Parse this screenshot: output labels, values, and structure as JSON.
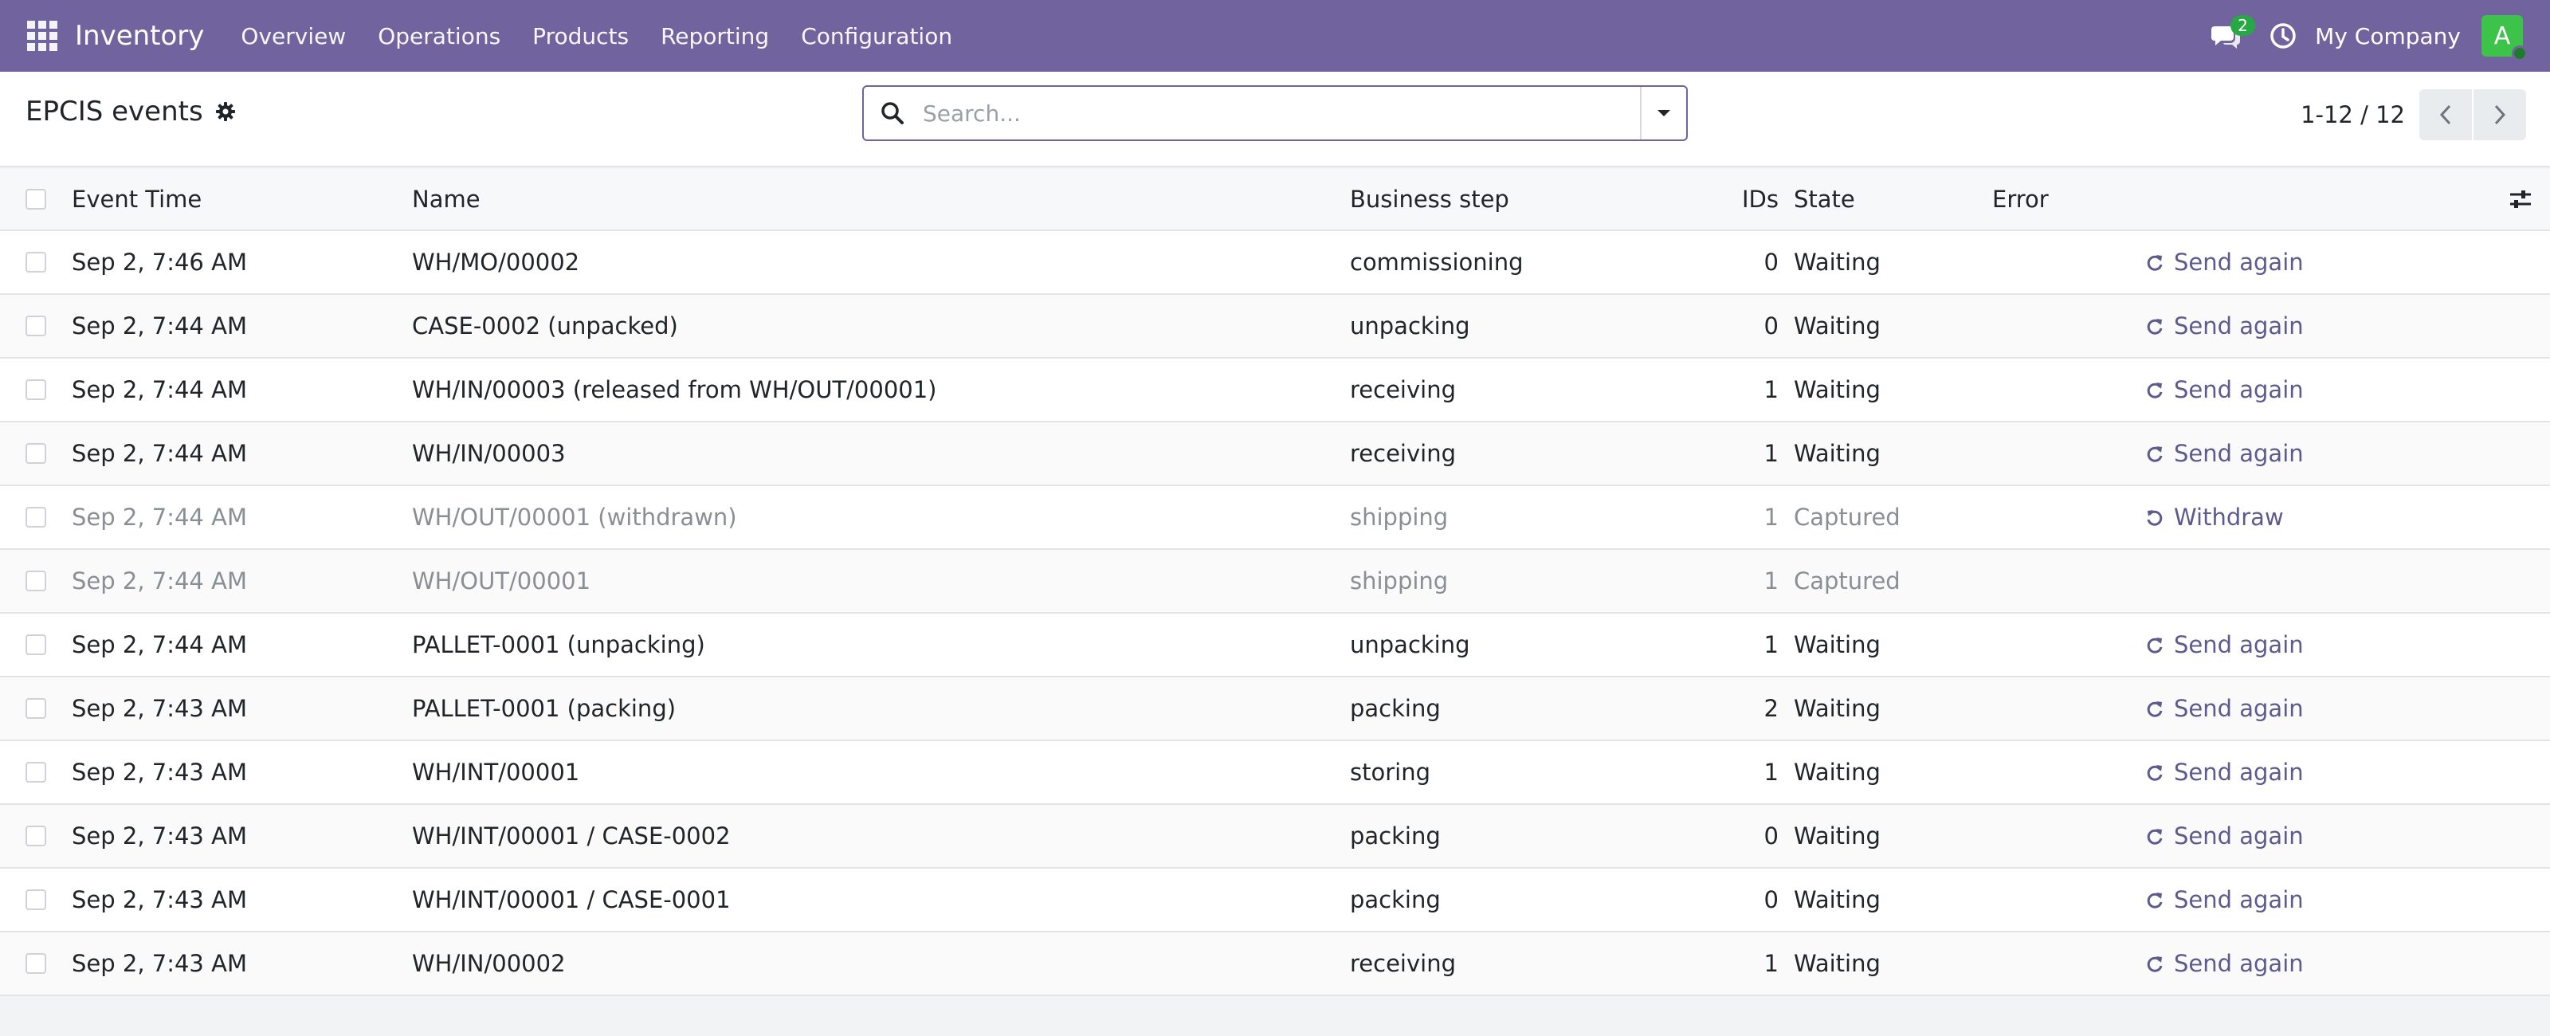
{
  "navbar": {
    "app_name": "Inventory",
    "menu": [
      "Overview",
      "Operations",
      "Products",
      "Reporting",
      "Configuration"
    ],
    "chat_count": "2",
    "company": "My Company",
    "avatar_letter": "A",
    "bg_color": "#71639e"
  },
  "control": {
    "title": "EPCIS events",
    "search_placeholder": "Search...",
    "pager": "1-12 / 12"
  },
  "table": {
    "columns": {
      "event_time": "Event Time",
      "name": "Name",
      "business_step": "Business step",
      "ids": "IDs",
      "state": "State",
      "error": "Error"
    },
    "rows": [
      {
        "time": "Sep 2, 7:46 AM",
        "name": "WH/MO/00002",
        "step": "commissioning",
        "ids": "0",
        "state": "Waiting",
        "error": "",
        "action": "Send again",
        "action_icon": "refresh-icon",
        "muted": false
      },
      {
        "time": "Sep 2, 7:44 AM",
        "name": "CASE-0002 (unpacked)",
        "step": "unpacking",
        "ids": "0",
        "state": "Waiting",
        "error": "",
        "action": "Send again",
        "action_icon": "refresh-icon",
        "muted": false
      },
      {
        "time": "Sep 2, 7:44 AM",
        "name": "WH/IN/00003 (released from WH/OUT/00001)",
        "step": "receiving",
        "ids": "1",
        "state": "Waiting",
        "error": "",
        "action": "Send again",
        "action_icon": "refresh-icon",
        "muted": false
      },
      {
        "time": "Sep 2, 7:44 AM",
        "name": "WH/IN/00003",
        "step": "receiving",
        "ids": "1",
        "state": "Waiting",
        "error": "",
        "action": "Send again",
        "action_icon": "refresh-icon",
        "muted": false
      },
      {
        "time": "Sep 2, 7:44 AM",
        "name": "WH/OUT/00001 (withdrawn)",
        "step": "shipping",
        "ids": "1",
        "state": "Captured",
        "error": "",
        "action": "Withdraw",
        "action_icon": "undo-icon",
        "muted": true
      },
      {
        "time": "Sep 2, 7:44 AM",
        "name": "WH/OUT/00001",
        "step": "shipping",
        "ids": "1",
        "state": "Captured",
        "error": "",
        "action": "",
        "action_icon": "",
        "muted": true
      },
      {
        "time": "Sep 2, 7:44 AM",
        "name": "PALLET-0001 (unpacking)",
        "step": "unpacking",
        "ids": "1",
        "state": "Waiting",
        "error": "",
        "action": "Send again",
        "action_icon": "refresh-icon",
        "muted": false
      },
      {
        "time": "Sep 2, 7:43 AM",
        "name": "PALLET-0001 (packing)",
        "step": "packing",
        "ids": "2",
        "state": "Waiting",
        "error": "",
        "action": "Send again",
        "action_icon": "refresh-icon",
        "muted": false
      },
      {
        "time": "Sep 2, 7:43 AM",
        "name": "WH/INT/00001",
        "step": "storing",
        "ids": "1",
        "state": "Waiting",
        "error": "",
        "action": "Send again",
        "action_icon": "refresh-icon",
        "muted": false
      },
      {
        "time": "Sep 2, 7:43 AM",
        "name": "WH/INT/00001 / CASE-0002",
        "step": "packing",
        "ids": "0",
        "state": "Waiting",
        "error": "",
        "action": "Send again",
        "action_icon": "refresh-icon",
        "muted": false
      },
      {
        "time": "Sep 2, 7:43 AM",
        "name": "WH/INT/00001 / CASE-0001",
        "step": "packing",
        "ids": "0",
        "state": "Waiting",
        "error": "",
        "action": "Send again",
        "action_icon": "refresh-icon",
        "muted": false
      },
      {
        "time": "Sep 2, 7:43 AM",
        "name": "WH/IN/00002",
        "step": "receiving",
        "ids": "1",
        "state": "Waiting",
        "error": "",
        "action": "Send again",
        "action_icon": "refresh-icon",
        "muted": false
      }
    ]
  }
}
